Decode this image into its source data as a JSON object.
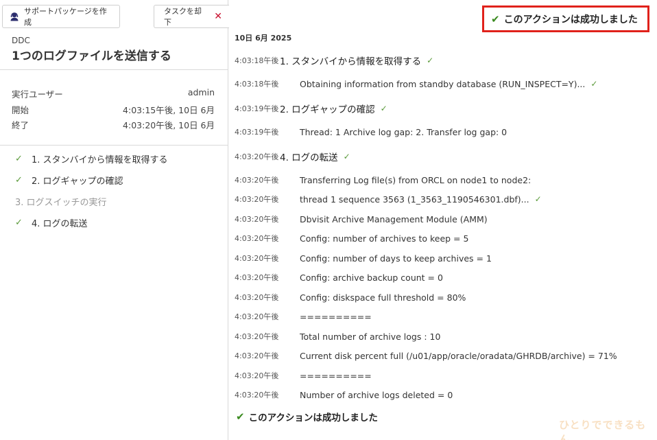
{
  "toolbar": {
    "support_label": "サポートパッケージを作成",
    "dismiss_label": "タスクを却下",
    "dismiss_icon": "close-icon"
  },
  "task": {
    "org": "DDC",
    "title": "1つのログファイルを送信する",
    "user_label": "実行ユーザー",
    "user_value": "admin",
    "start_label": "開始",
    "start_value": "4:03:15午後, 10日 6月",
    "end_label": "終了",
    "end_value": "4:03:20午後, 10日 6月"
  },
  "steps": [
    {
      "label": "1. スタンバイから情報を取得する",
      "status": "done"
    },
    {
      "label": "2. ログギャップの確認",
      "status": "done"
    },
    {
      "label": "3. ログスイッチの実行",
      "status": "skipped"
    },
    {
      "label": "4. ログの転送",
      "status": "done"
    }
  ],
  "log": {
    "success_message": "このアクションは成功しました",
    "date": "10日 6月 2025",
    "entries": [
      {
        "ts": "4:03:18午後",
        "text": "1. スタンバイから情報を取得する",
        "kind": "header",
        "ok": true
      },
      {
        "ts": "4:03:18午後",
        "text": "Obtaining information from standby database (RUN_INSPECT=Y)...",
        "kind": "detail",
        "ok": true
      },
      {
        "ts": "4:03:19午後",
        "text": "2. ログギャップの確認",
        "kind": "header",
        "ok": true
      },
      {
        "ts": "4:03:19午後",
        "text": "Thread: 1 Archive log gap: 2. Transfer log gap: 0",
        "kind": "detail",
        "ok": false
      },
      {
        "ts": "4:03:20午後",
        "text": "4. ログの転送",
        "kind": "header",
        "ok": true
      },
      {
        "ts": "4:03:20午後",
        "text": "Transferring Log file(s) from ORCL on node1 to node2:",
        "kind": "detail",
        "ok": false
      },
      {
        "ts": "4:03:20午後",
        "text": "thread 1 sequence 3563 (1_3563_1190546301.dbf)...",
        "kind": "detail",
        "ok": true
      },
      {
        "ts": "4:03:20午後",
        "text": "Dbvisit Archive Management Module (AMM)",
        "kind": "detail",
        "ok": false
      },
      {
        "ts": "4:03:20午後",
        "text": "Config: number of archives to keep = 5",
        "kind": "detail",
        "ok": false
      },
      {
        "ts": "4:03:20午後",
        "text": "Config: number of days to keep archives = 1",
        "kind": "detail",
        "ok": false
      },
      {
        "ts": "4:03:20午後",
        "text": "Config: archive backup count = 0",
        "kind": "detail",
        "ok": false
      },
      {
        "ts": "4:03:20午後",
        "text": "Config: diskspace full threshold = 80%",
        "kind": "detail",
        "ok": false
      },
      {
        "ts": "4:03:20午後",
        "text": "==========",
        "kind": "detail",
        "ok": false
      },
      {
        "ts": "4:03:20午後",
        "text": "Total number of archive logs : 10",
        "kind": "detail",
        "ok": false
      },
      {
        "ts": "4:03:20午後",
        "text": "Current disk percent full (/u01/app/oracle/oradata/GHRDB/archive) = 71%",
        "kind": "detail",
        "ok": false
      },
      {
        "ts": "4:03:20午後",
        "text": "==========",
        "kind": "detail",
        "ok": false
      },
      {
        "ts": "4:03:20午後",
        "text": "Number of archive logs deleted = 0",
        "kind": "detail",
        "ok": false
      }
    ]
  },
  "watermark": "ひとりでできるもん",
  "colors": {
    "success_green": "#3a8a1f",
    "highlight_red": "#e0211b",
    "dismiss_red": "#c8102e"
  }
}
